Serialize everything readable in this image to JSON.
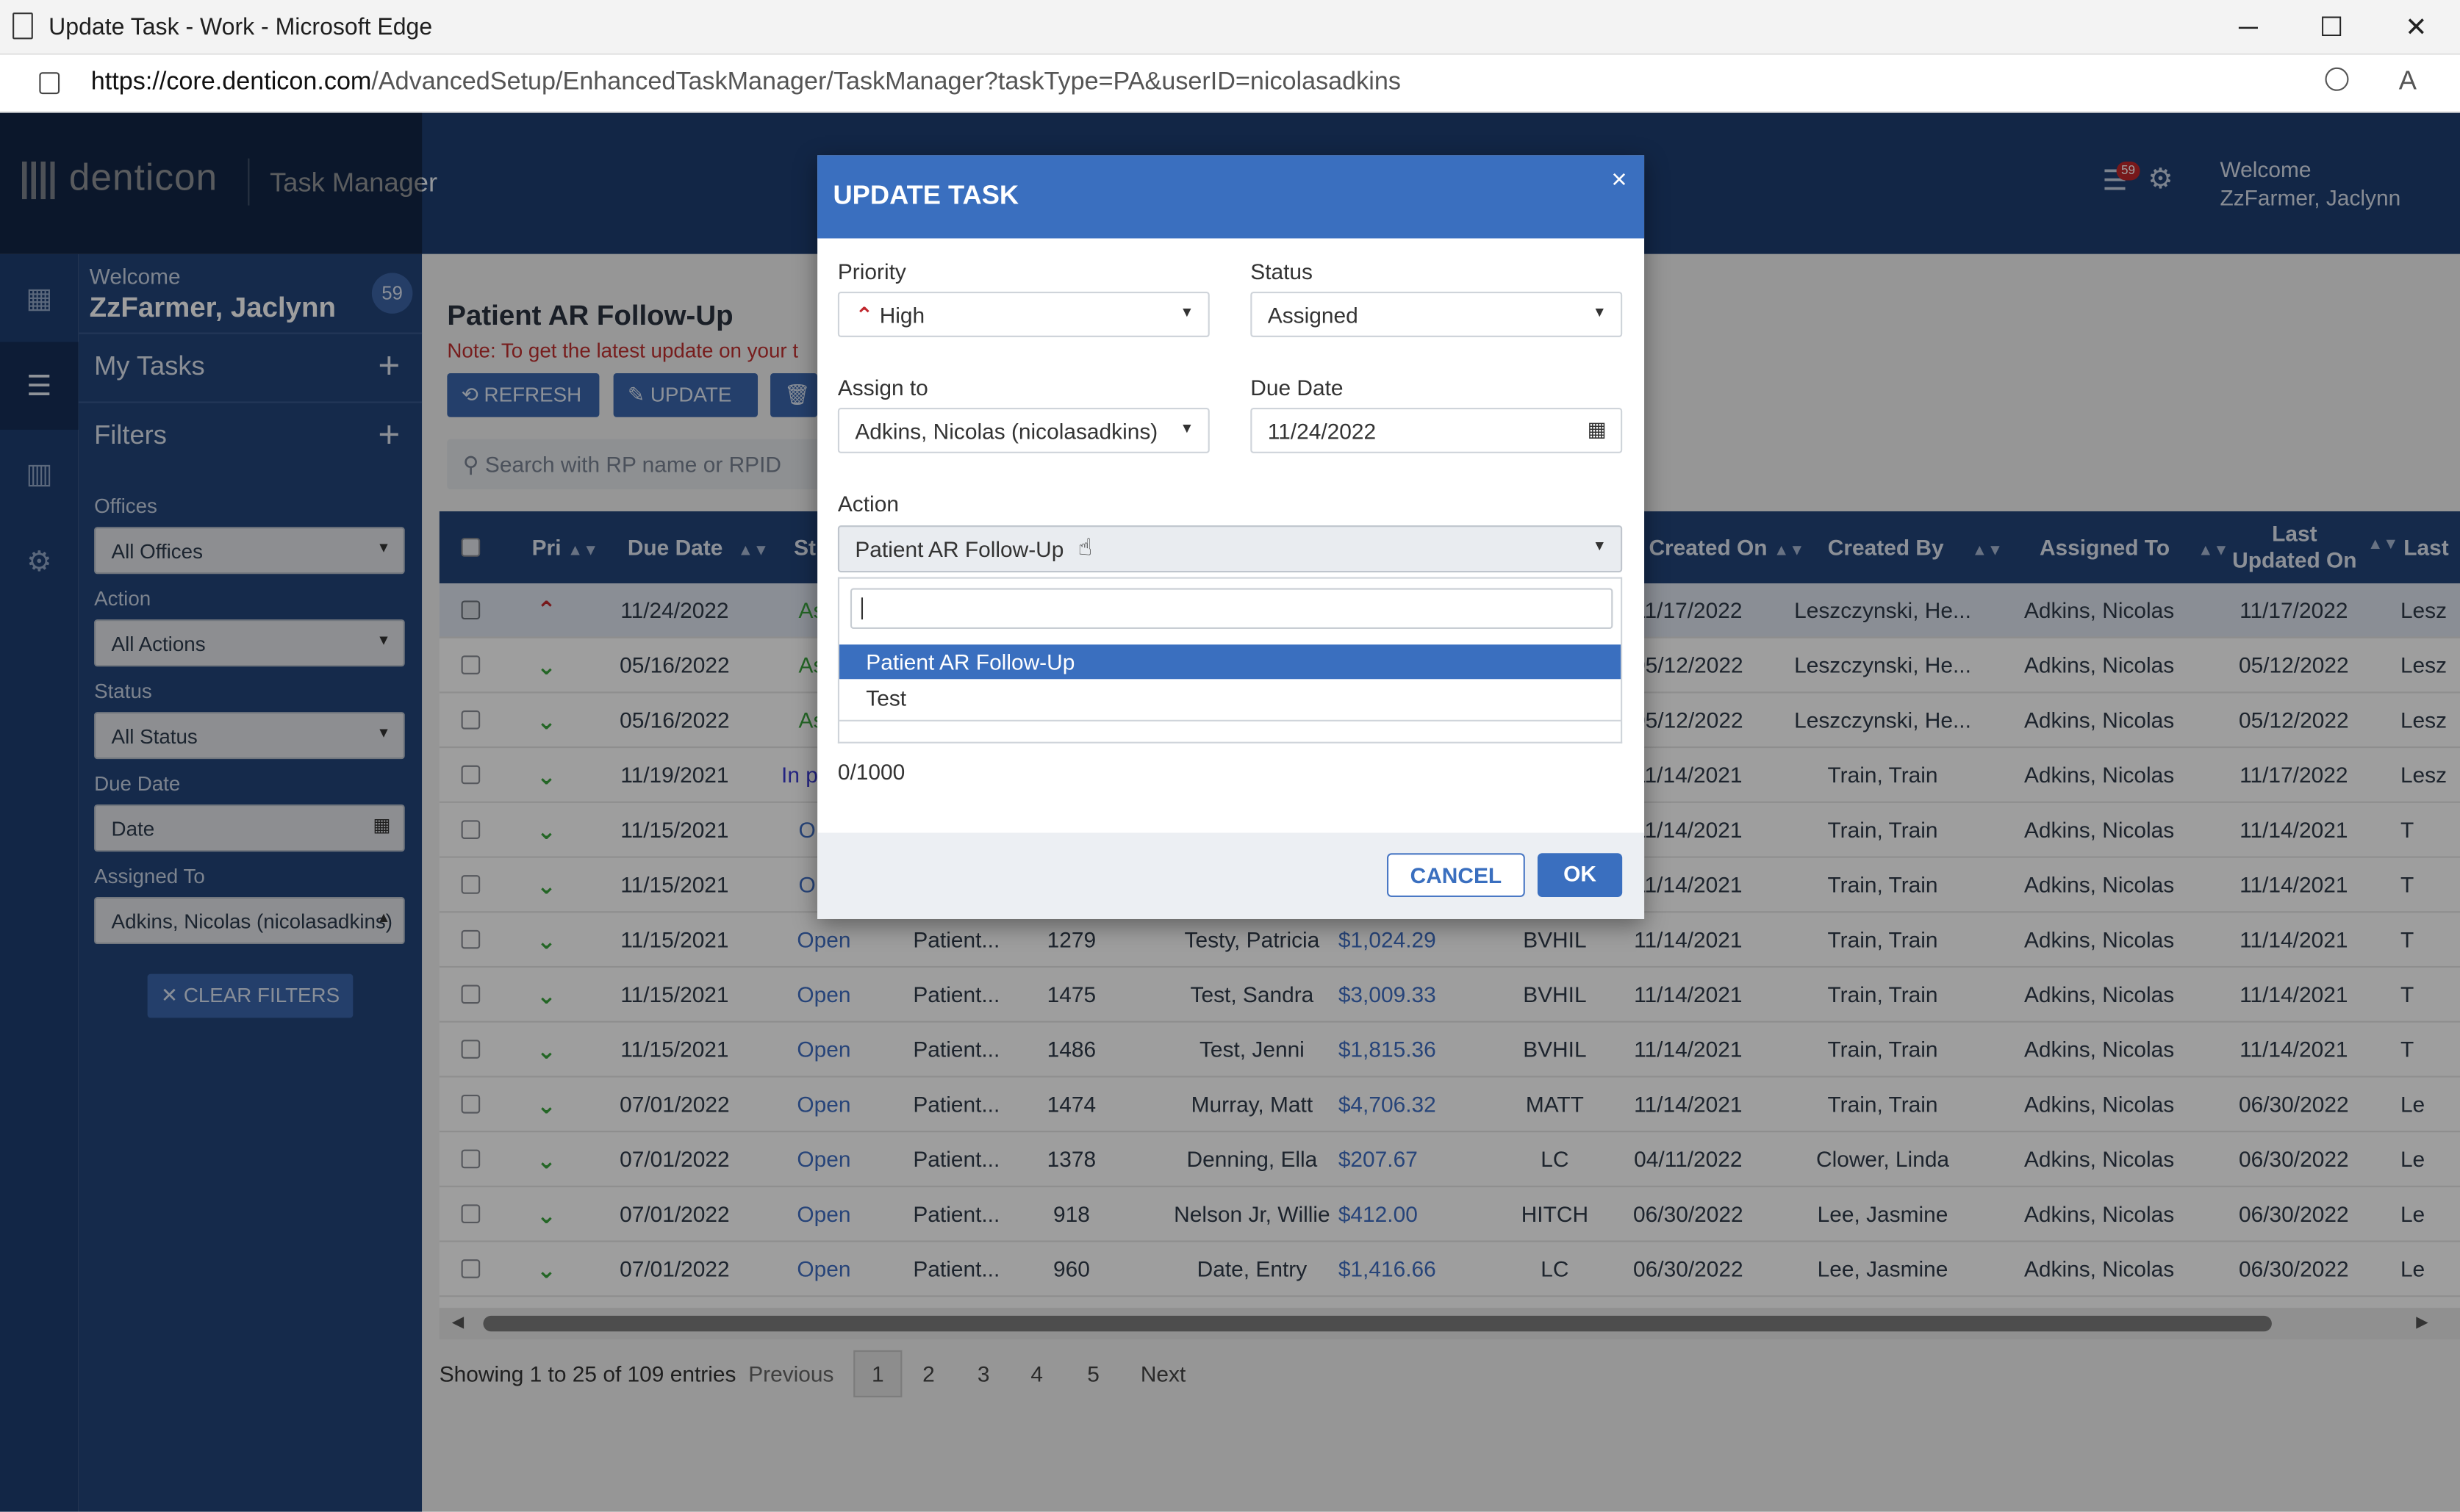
{
  "window": {
    "title": "Update Task - Work - Microsoft Edge",
    "minimize": "─",
    "maximize": "☐",
    "close": "✕"
  },
  "browser": {
    "url_host": "https://core.denticon.com",
    "url_path": "/AdvancedSetup/EnhancedTaskManager/TaskManager?taskType=PA&userID=nicolasadkins"
  },
  "app": {
    "logo": "denticon",
    "module": "Task Manager",
    "notif_count": "59",
    "welcome_label": "Welcome",
    "user": "ZzFarmer, Jaclynn"
  },
  "sidebar": {
    "welcome": "Welcome",
    "user": "ZzFarmer, Jaclynn",
    "count": "59",
    "my_tasks": "My Tasks",
    "filters": "Filters",
    "add": "+",
    "fields": [
      {
        "label": "Offices",
        "value": "All Offices"
      },
      {
        "label": "Action",
        "value": "All Actions"
      },
      {
        "label": "Status",
        "value": "All Status"
      },
      {
        "label": "Due Date",
        "value": "Date"
      },
      {
        "label": "Assigned To",
        "value": "Adkins, Nicolas (nicolasadkins)"
      }
    ],
    "clear": "CLEAR FILTERS"
  },
  "main": {
    "title": "Patient AR Follow-Up",
    "note": "Note: To get the latest update on your t",
    "refresh": "REFRESH",
    "update": "UPDATE",
    "search_placeholder": "Search with RP name or RPID"
  },
  "table": {
    "headers": {
      "pri": "Pri",
      "due": "Due Date",
      "st": "St",
      "created_on": "Created On",
      "created_by": "Created By",
      "assigned": "Assigned To",
      "last1": "Last",
      "last2": "Updated On",
      "last_col": "Last"
    },
    "rows": [
      {
        "pri": "up",
        "due": "11/24/2022",
        "status": "Ass",
        "action": "",
        "rp": "",
        "name": "",
        "amt": "",
        "office": "",
        "created": "11/17/2022",
        "by": "Leszczynski, He...",
        "to": "Adkins, Nicolas",
        "upd": "11/17/2022",
        "last": "Lesz"
      },
      {
        "pri": "down",
        "due": "05/16/2022",
        "status": "Ass",
        "action": "",
        "rp": "",
        "name": "",
        "amt": "",
        "office": "",
        "created": "05/12/2022",
        "by": "Leszczynski, He...",
        "to": "Adkins, Nicolas",
        "upd": "05/12/2022",
        "last": "Lesz"
      },
      {
        "pri": "down",
        "due": "05/16/2022",
        "status": "Ass",
        "action": "",
        "rp": "",
        "name": "",
        "amt": "",
        "office": "",
        "created": "05/12/2022",
        "by": "Leszczynski, He...",
        "to": "Adkins, Nicolas",
        "upd": "05/12/2022",
        "last": "Lesz"
      },
      {
        "pri": "down",
        "due": "11/19/2021",
        "status": "In p",
        "action": "",
        "rp": "",
        "name": "",
        "amt": "",
        "office": "",
        "created": "11/14/2021",
        "by": "Train, Train",
        "to": "Adkins, Nicolas",
        "upd": "11/17/2022",
        "last": "Lesz"
      },
      {
        "pri": "down",
        "due": "11/15/2021",
        "status": "O",
        "action": "",
        "rp": "",
        "name": "",
        "amt": "",
        "office": "",
        "created": "11/14/2021",
        "by": "Train, Train",
        "to": "Adkins, Nicolas",
        "upd": "11/14/2021",
        "last": "T"
      },
      {
        "pri": "down",
        "due": "11/15/2021",
        "status": "O",
        "action": "",
        "rp": "",
        "name": "",
        "amt": "",
        "office": "",
        "created": "11/14/2021",
        "by": "Train, Train",
        "to": "Adkins, Nicolas",
        "upd": "11/14/2021",
        "last": "T"
      },
      {
        "pri": "down",
        "due": "11/15/2021",
        "status": "Open",
        "action": "Patient...",
        "rp": "1279",
        "name": "Testy, Patricia",
        "amt": "$1,024.29",
        "office": "BVHIL",
        "created": "11/14/2021",
        "by": "Train, Train",
        "to": "Adkins, Nicolas",
        "upd": "11/14/2021",
        "last": "T"
      },
      {
        "pri": "down",
        "due": "11/15/2021",
        "status": "Open",
        "action": "Patient...",
        "rp": "1475",
        "name": "Test, Sandra",
        "amt": "$3,009.33",
        "office": "BVHIL",
        "created": "11/14/2021",
        "by": "Train, Train",
        "to": "Adkins, Nicolas",
        "upd": "11/14/2021",
        "last": "T"
      },
      {
        "pri": "down",
        "due": "11/15/2021",
        "status": "Open",
        "action": "Patient...",
        "rp": "1486",
        "name": "Test, Jenni",
        "amt": "$1,815.36",
        "office": "BVHIL",
        "created": "11/14/2021",
        "by": "Train, Train",
        "to": "Adkins, Nicolas",
        "upd": "11/14/2021",
        "last": "T"
      },
      {
        "pri": "down",
        "due": "07/01/2022",
        "status": "Open",
        "action": "Patient...",
        "rp": "1474",
        "name": "Murray, Matt",
        "amt": "$4,706.32",
        "office": "MATT",
        "created": "11/14/2021",
        "by": "Train, Train",
        "to": "Adkins, Nicolas",
        "upd": "06/30/2022",
        "last": "Le"
      },
      {
        "pri": "down",
        "due": "07/01/2022",
        "status": "Open",
        "action": "Patient...",
        "rp": "1378",
        "name": "Denning, Ella",
        "amt": "$207.67",
        "office": "LC",
        "created": "04/11/2022",
        "by": "Clower, Linda",
        "to": "Adkins, Nicolas",
        "upd": "06/30/2022",
        "last": "Le"
      },
      {
        "pri": "down",
        "due": "07/01/2022",
        "status": "Open",
        "action": "Patient...",
        "rp": "918",
        "name": "Nelson Jr, Willie",
        "amt": "$412.00",
        "office": "HITCH",
        "created": "06/30/2022",
        "by": "Lee, Jasmine",
        "to": "Adkins, Nicolas",
        "upd": "06/30/2022",
        "last": "Le"
      },
      {
        "pri": "down",
        "due": "07/01/2022",
        "status": "Open",
        "action": "Patient...",
        "rp": "960",
        "name": "Date, Entry",
        "amt": "$1,416.66",
        "office": "LC",
        "created": "06/30/2022",
        "by": "Lee, Jasmine",
        "to": "Adkins, Nicolas",
        "upd": "06/30/2022",
        "last": "Le"
      }
    ]
  },
  "pager": {
    "info": "Showing 1 to 25 of 109 entries",
    "previous": "Previous",
    "pages": [
      "1",
      "2",
      "3",
      "4",
      "5"
    ],
    "next": "Next"
  },
  "modal": {
    "title": "UPDATE TASK",
    "close": "×",
    "priority_label": "Priority",
    "priority_value": "High",
    "status_label": "Status",
    "status_value": "Assigned",
    "assign_label": "Assign to",
    "assign_value": "Adkins, Nicolas (nicolasadkins)",
    "due_label": "Due Date",
    "due_value": "11/24/2022",
    "action_label": "Action",
    "action_value": "Patient AR Follow-Up",
    "options": [
      "Patient AR Follow-Up",
      "Test"
    ],
    "counter": "0/1000",
    "cancel": "CANCEL",
    "ok": "OK"
  },
  "colors": {
    "nav": "#1d3e72",
    "accent": "#3a6fbf",
    "open": "#3f6fc4",
    "assigned": "#3aa53e",
    "priority_high": "#c0272d",
    "priority_low": "#3aa53e"
  }
}
